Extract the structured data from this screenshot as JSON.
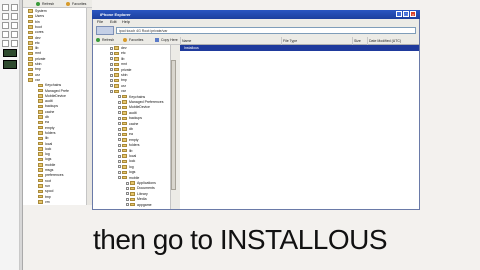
{
  "window": {
    "title": "iPhone Explorer",
    "close_glyph": "×",
    "minimize_glyph": "_",
    "maximize_glyph": "□"
  },
  "menu": [
    "File",
    "Edit",
    "Help"
  ],
  "address": {
    "path": "ipod touch 4G Root:/private/var"
  },
  "toolbar": [
    {
      "label": "Refresh",
      "icon": "refresh-icon"
    },
    {
      "label": "Favorites",
      "icon": "star-icon"
    },
    {
      "label": "Copy Here",
      "icon": "copy-icon"
    },
    {
      "label": "Delete Items",
      "icon": "delete-icon"
    },
    {
      "label": "New Filesharing Device",
      "icon": "device-icon"
    }
  ],
  "bg_toolbar": [
    {
      "label": "Refresh"
    },
    {
      "label": "Favorites"
    }
  ],
  "bg_tree": [
    "System",
    "Users",
    "bin",
    "boot",
    "cores",
    "dev",
    "etc",
    "lib",
    "mnt",
    "private",
    "sbin",
    "tmp",
    "usr",
    "var",
    "Keychains",
    "Managed Prefe",
    "MobileDevice",
    "audit",
    "backups",
    "cache",
    "db",
    "ea",
    "empty",
    "folders",
    "lib",
    "local",
    "lock",
    "log",
    "logs",
    "mobile",
    "msgs",
    "preferences",
    "root",
    "run",
    "spool",
    "tmp",
    "vm"
  ],
  "tree": [
    "dev",
    "etc",
    "lib",
    "mnt",
    "private",
    "sbin",
    "tmp",
    "usr",
    "var",
    "Keychains",
    "Managed Preferences",
    "MobileDevice",
    "audit",
    "backups",
    "cache",
    "db",
    "ea",
    "empty",
    "folders",
    "lib",
    "local",
    "lock",
    "log",
    "logs",
    "mobile",
    "Applications",
    "Documents",
    "Library",
    "Media",
    "appgame"
  ],
  "list": {
    "columns": [
      "Name",
      "File Type",
      "Size",
      "Date Modified (UTC)"
    ],
    "rows": [
      {
        "name": "Installous",
        "type": "",
        "size": "",
        "date": ""
      }
    ]
  },
  "caption": "then go to INSTALLOUS",
  "colors": {
    "titlebar": "#1c3f9e",
    "selection": "#1f3a9c",
    "folder": "#e6c56a"
  }
}
